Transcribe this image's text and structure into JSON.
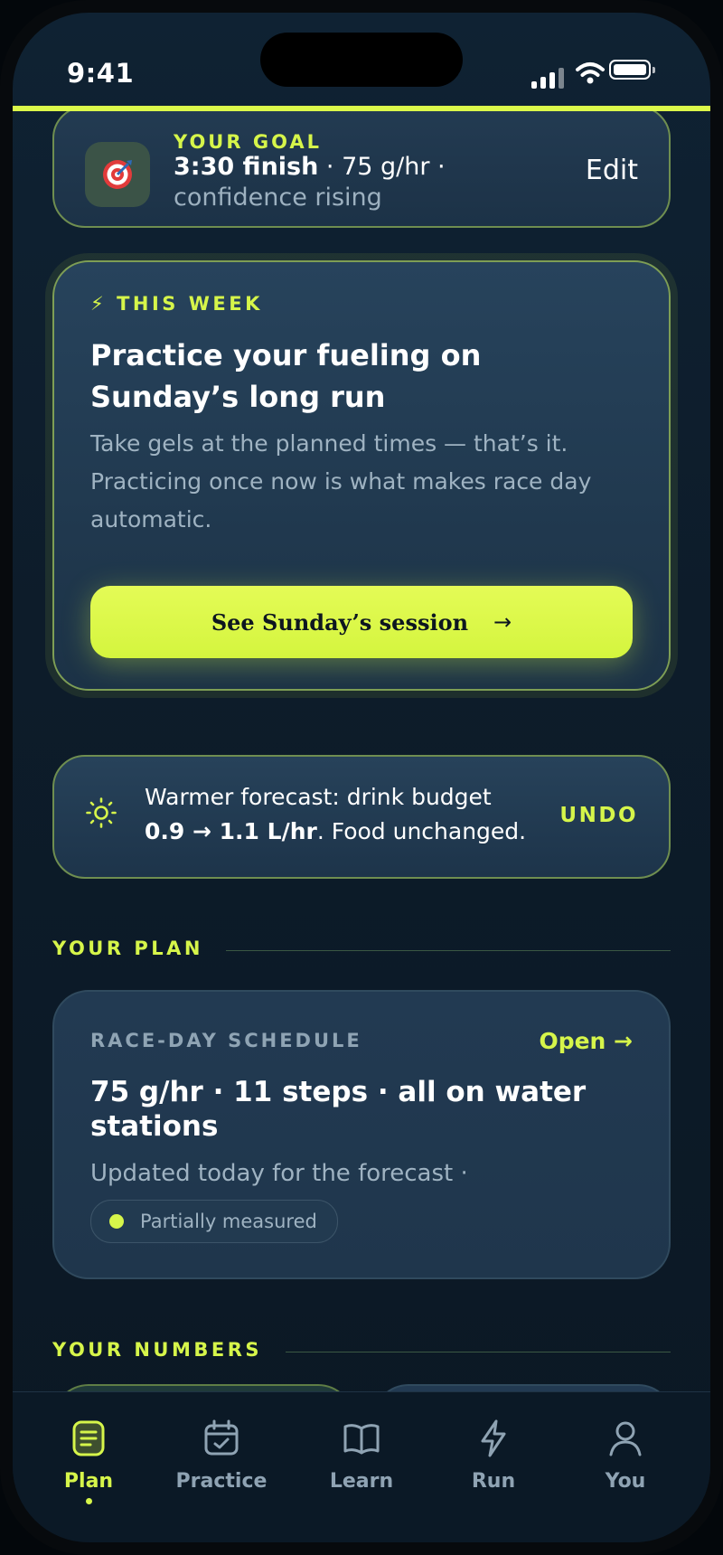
{
  "status_bar": {
    "time": "9:41"
  },
  "colors": {
    "accent": "#dcf94a",
    "background": "#0f2233",
    "card": "#223a52",
    "muted_text": "#9fb3c2"
  },
  "goal": {
    "label": "YOUR GOAL",
    "finish": "3:30 finish",
    "rate": " · 75 g/hr ·",
    "mood": "confidence rising",
    "edit_label": "Edit",
    "icon": "target-icon"
  },
  "this_week": {
    "label": "THIS WEEK",
    "icon": "lightning-icon",
    "title": "Practice your fueling on Sunday’s long run",
    "body": "Take gels at the planned times — that’s it. Practicing once now is what makes race day automatic.",
    "cta_label": "See Sunday’s session",
    "cta_arrow": "→"
  },
  "forecast": {
    "icon": "sun-icon",
    "line1": "Warmer forecast: drink budget",
    "budget_change": "0.9 → 1.1 L/hr",
    "line2_rest": ". Food unchanged.",
    "undo_label": "UNDO"
  },
  "plan_section": {
    "heading": "YOUR PLAN"
  },
  "schedule": {
    "label": "RACE-DAY SCHEDULE",
    "open_label": "Open →",
    "title": "75 g/hr · 11 steps · all on water stations",
    "updated": "Updated today for the forecast ·",
    "badge": "Partially measured"
  },
  "numbers_section": {
    "heading": "YOUR NUMBERS"
  },
  "tabs": [
    {
      "label": "Plan",
      "icon": "document-list-icon",
      "active": true
    },
    {
      "label": "Practice",
      "icon": "calendar-check-icon",
      "active": false
    },
    {
      "label": "Learn",
      "icon": "book-open-icon",
      "active": false
    },
    {
      "label": "Run",
      "icon": "lightning-icon",
      "active": false
    },
    {
      "label": "You",
      "icon": "user-icon",
      "active": false
    }
  ]
}
